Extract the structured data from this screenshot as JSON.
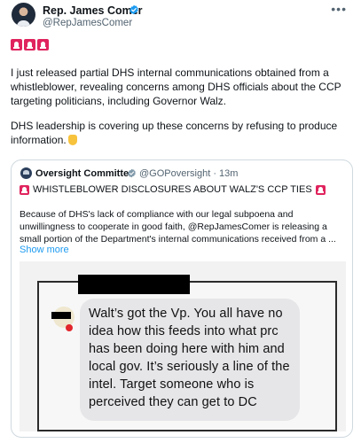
{
  "author": {
    "display_name": "Rep. James Comer",
    "handle": "@RepJamesComer",
    "verified_icon": "verified-badge-icon",
    "more_icon": "more-options-icon"
  },
  "tweet": {
    "paragraph_1": "I just released partial DHS internal communications obtained from a whistleblower, revealing concerns among DHS officials about the CCP targeting politicians, including Governor Walz.",
    "paragraph_2": "DHS leadership is covering up these concerns by refusing to produce information.",
    "emoji": "pointing-down-emoji"
  },
  "quote": {
    "name": "Oversight Committee",
    "handle": "@GOPoversight",
    "separator": "·",
    "time": "13m",
    "headline": "WHISTLEBLOWER DISCLOSURES ABOUT WALZ'S CCP TIES",
    "body": "Because of DHS's lack of compliance with our legal subpoena and unwillingness to cooperate in good faith, @RepJamesComer is releasing a small portion of the Department's internal communications received from a ...",
    "show_more": "Show more",
    "media_text": "Walt’s got the Vp.  You all have no idea how this feeds into what prc has been doing here with him and local gov.  It’s seriously a line of the intel.  Target someone who is perceived they can get to DC"
  },
  "colors": {
    "accent": "#1d9bf0",
    "siren": "#e0245e",
    "border": "#cfd9de",
    "muted_text": "#536471"
  }
}
